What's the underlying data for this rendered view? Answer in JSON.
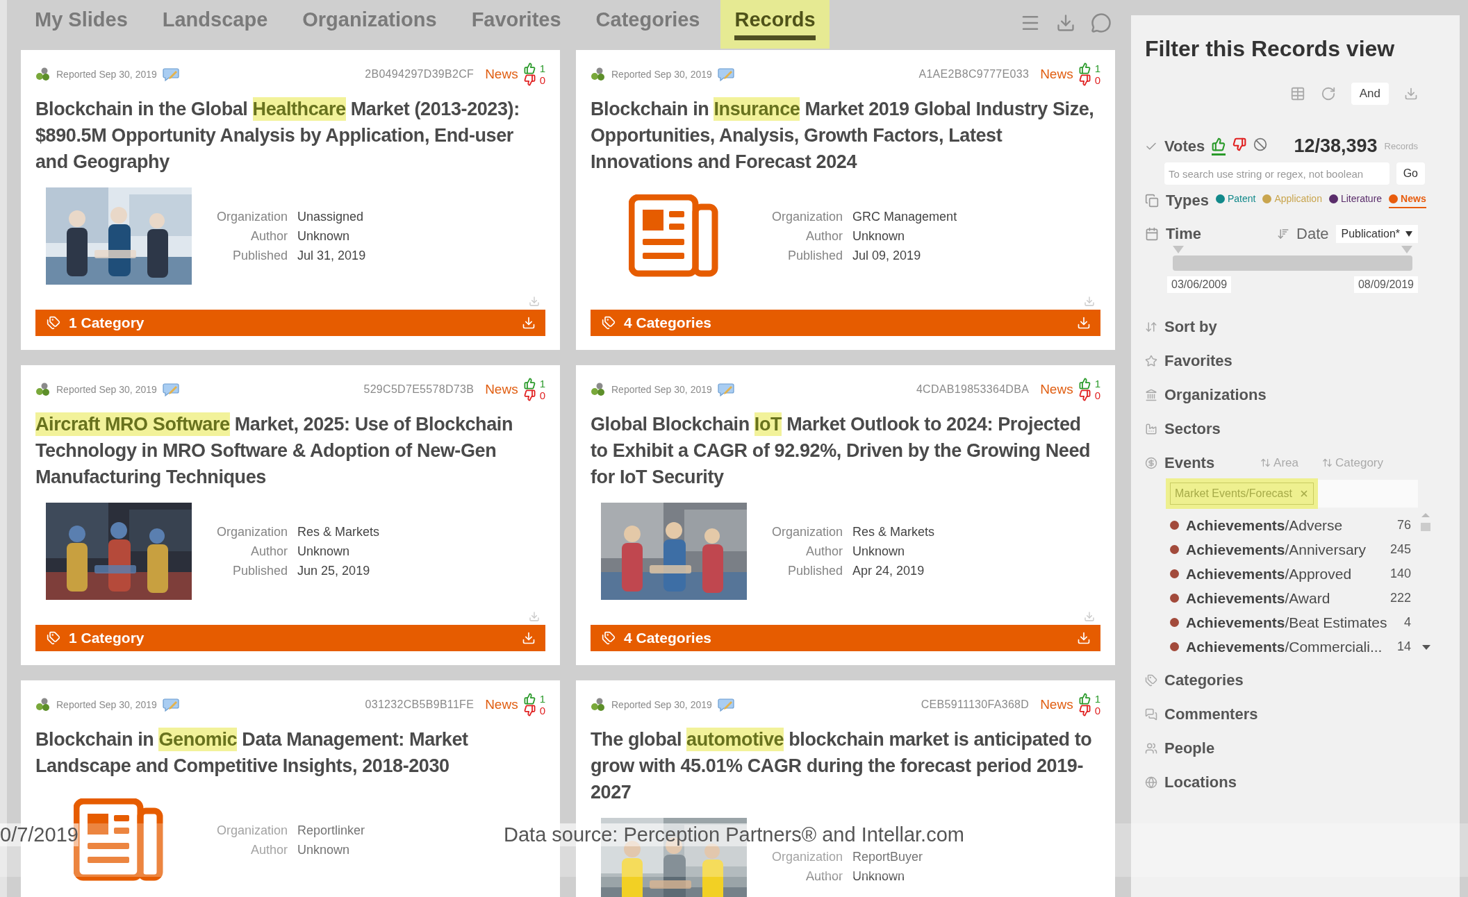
{
  "nav": {
    "tabs": [
      {
        "label": "My Slides",
        "selected": false
      },
      {
        "label": "Landscape",
        "selected": false
      },
      {
        "label": "Organizations",
        "selected": false
      },
      {
        "label": "Favorites",
        "selected": false
      },
      {
        "label": "Categories",
        "selected": false
      },
      {
        "label": "Records",
        "selected": true
      }
    ]
  },
  "columns": [
    {
      "cards": [
        {
          "reported": "Reported Sep 30, 2019",
          "record_id": "2B0494297D39B2CF",
          "type": "News",
          "up_votes": "1",
          "down_votes": "0",
          "title_parts": [
            {
              "text": "Blockchain in the Global ",
              "highlighted": false
            },
            {
              "text": "Healthcare",
              "highlighted": true
            },
            {
              "text": " Market (2013-2023): $890.5M Opportunity Analysis by Application, End-user and Geography",
              "highlighted": false
            }
          ],
          "thumbnail": {
            "kind": "picture"
          },
          "fields": [
            {
              "label": "Organization",
              "value": "Unassigned"
            },
            {
              "label": "Author",
              "value": "Unknown"
            },
            {
              "label": "Published",
              "value": "Jul 31, 2019"
            }
          ],
          "categories": "1 Category"
        },
        {
          "reported": "Reported Sep 30, 2019",
          "record_id": "529C5D7E5578D73B",
          "type": "News",
          "up_votes": "1",
          "down_votes": "0",
          "title_parts": [
            {
              "text": "Aircraft MRO Software",
              "highlighted": true
            },
            {
              "text": " Market, 2025: Use of Blockchain Technology in MRO Software & Adoption of New-Gen Manufacturing Techniques",
              "highlighted": false
            }
          ],
          "thumbnail": {
            "kind": "picture"
          },
          "fields": [
            {
              "label": "Organization",
              "value": "Res & Markets"
            },
            {
              "label": "Author",
              "value": "Unknown"
            },
            {
              "label": "Published",
              "value": "Jun 25, 2019"
            }
          ],
          "categories": "1 Category"
        },
        {
          "reported": "Reported Sep 30, 2019",
          "record_id": "031232CB5B9B11FE",
          "type": "News",
          "up_votes": "1",
          "down_votes": "0",
          "title_parts": [
            {
              "text": "Blockchain in ",
              "highlighted": false
            },
            {
              "text": "Genomic",
              "highlighted": true
            },
            {
              "text": " Data Management: Market Landscape and Competitive Insights, 2018-2030",
              "highlighted": false
            }
          ],
          "thumbnail": {
            "kind": "newspaper"
          },
          "fields": [
            {
              "label": "Organization",
              "value": "Reportlinker"
            },
            {
              "label": "Author",
              "value": "Unknown"
            }
          ]
        }
      ]
    },
    {
      "cards": [
        {
          "reported": "Reported Sep 30, 2019",
          "record_id": "A1AE2B8C9777E033",
          "type": "News",
          "up_votes": "1",
          "down_votes": "0",
          "title_parts": [
            {
              "text": "Blockchain in ",
              "highlighted": false
            },
            {
              "text": "Insurance",
              "highlighted": true
            },
            {
              "text": " Market 2019 Global Industry Size, Opportunities, Analysis, Growth Factors, Latest Innovations and Forecast 2024",
              "highlighted": false
            }
          ],
          "thumbnail": {
            "kind": "newspaper"
          },
          "fields": [
            {
              "label": "Organization",
              "value": "GRC Management"
            },
            {
              "label": "Author",
              "value": "Unknown"
            },
            {
              "label": "Published",
              "value": "Jul 09, 2019"
            }
          ],
          "categories": "4 Categories"
        },
        {
          "reported": "Reported Sep 30, 2019",
          "record_id": "4CDAB19853364DBA",
          "type": "News",
          "up_votes": "1",
          "down_votes": "0",
          "title_parts": [
            {
              "text": "Global Blockchain ",
              "highlighted": false
            },
            {
              "text": "IoT",
              "highlighted": true
            },
            {
              "text": " Market Outlook to 2024: Projected to Exhibit a CAGR of 92.92%, Driven by the Growing Need for IoT Security",
              "highlighted": false
            }
          ],
          "thumbnail": {
            "kind": "picture"
          },
          "fields": [
            {
              "label": "Organization",
              "value": "Res & Markets"
            },
            {
              "label": "Author",
              "value": "Unknown"
            },
            {
              "label": "Published",
              "value": "Apr 24, 2019"
            }
          ],
          "categories": "4 Categories"
        },
        {
          "reported": "Reported Sep 30, 2019",
          "record_id": "CEB5911130FA368D",
          "type": "News",
          "up_votes": "1",
          "down_votes": "0",
          "title_parts": [
            {
              "text": "The global ",
              "highlighted": false
            },
            {
              "text": "automotive",
              "highlighted": true
            },
            {
              "text": " blockchain market is anticipated to grow with 45.01% CAGR during the forecast period 2019-2027",
              "highlighted": false
            }
          ],
          "thumbnail": {
            "kind": "picture"
          },
          "fields": [
            {
              "label": "Organization",
              "value": "ReportBuyer"
            },
            {
              "label": "Author",
              "value": "Unknown"
            }
          ]
        }
      ]
    }
  ],
  "sidebar": {
    "title": "Filter this Records view",
    "logic_button": "And",
    "votes": {
      "label": "Votes",
      "filters": [
        {
          "kind": "up",
          "selected": true
        },
        {
          "kind": "down",
          "selected": false
        },
        {
          "kind": "none",
          "selected": false
        }
      ],
      "count": "12/38,393",
      "count_unit": "Records"
    },
    "search": {
      "placeholder": "To search use string or regex, not boolean",
      "button": "Go"
    },
    "types": {
      "label": "Types",
      "items": [
        {
          "label": "Patent",
          "color": "#12898a",
          "selected": false
        },
        {
          "label": "Application",
          "color": "#c9a54e",
          "selected": false
        },
        {
          "label": "Literature",
          "color": "#5a2d6b",
          "selected": false
        },
        {
          "label": "News",
          "color": "#e85c0d",
          "selected": true
        }
      ]
    },
    "time": {
      "label": "Time",
      "date_label": "Date",
      "date_select": "Publication*",
      "start": "03/06/2009",
      "end": "08/09/2019",
      "thumbs": [
        {
          "level": 0
        },
        {
          "level": 1
        }
      ]
    },
    "facets": [
      {
        "kind": "plain",
        "label": "Sort by"
      },
      {
        "kind": "plain",
        "label": "Favorites"
      },
      {
        "kind": "plain",
        "label": "Organizations"
      },
      {
        "kind": "plain",
        "label": "Sectors"
      },
      {
        "kind": "events",
        "label": "Events",
        "sort_options": [
          "Area",
          "Category"
        ],
        "tag": "Market Events/Forecast",
        "items": [
          {
            "name": "**Achievements**/Adverse",
            "count": "76"
          },
          {
            "name": "**Achievements**/Anniversary",
            "count": "245"
          },
          {
            "name": "**Achievements**/Approved",
            "count": "140"
          },
          {
            "name": "**Achievements**/Award",
            "count": "222"
          },
          {
            "name": "**Achievements**/Beat Estimates",
            "count": "4"
          },
          {
            "name": "**Achievements**/Commerciali...",
            "count": "14"
          }
        ]
      },
      {
        "kind": "plain",
        "label": "Categories"
      },
      {
        "kind": "plain",
        "label": "Commenters"
      },
      {
        "kind": "plain",
        "label": "People"
      },
      {
        "kind": "plain",
        "label": "Locations"
      }
    ]
  },
  "footer": {
    "date": "0/7/2019",
    "source": "Data source: Perception Partners® and Intellar.com"
  }
}
